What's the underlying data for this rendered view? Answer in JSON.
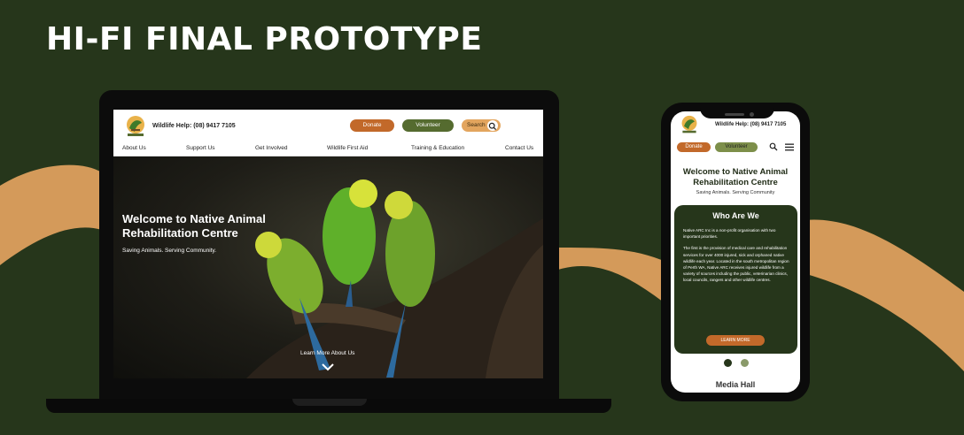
{
  "page_title": "HI-FI FINAL PROTOTYPE",
  "colors": {
    "background": "#26361b",
    "accent_orange": "#c2692a",
    "accent_green": "#556b2f",
    "swoosh": "#d49a5a"
  },
  "desktop": {
    "wildlife_help": "Wildlife Help: (08) 9417 7105",
    "donate_label": "Donate",
    "volunteer_label": "Volunteer",
    "search_label": "Search",
    "nav": [
      "About Us",
      "Support Us",
      "Get Involved",
      "Wildlife First Aid",
      "Training & Education",
      "Contact Us"
    ],
    "hero_title": "Welcome to Native Animal Rehabilitation Centre",
    "hero_subtitle": "Saving Animals. Serving Community.",
    "learn_more_label": "Learn More About Us"
  },
  "mobile": {
    "wildlife_help": "Wildlife Help: (08) 9417 7105",
    "donate_label": "Donate",
    "volunteer_label": "Volunteer",
    "hero_title": "Welcome to Native Animal Rehabilitation Centre",
    "hero_subtitle": "Saving Animals. Serving Community",
    "card_title": "Who Are We",
    "card_para1": "Native ARC Inc is a non-profit organisation with two important priorities.",
    "card_para2": "The first is the provision of medical care and rehabilitation services for over 4000 injured, sick and orphaned native wildlife each year. Located in the south metropolitan region of Perth WA, Native ARC receives injured wildlife from a variety of sources including the public, veterinarian clinics, local councils, rangers and other wildlife centres.",
    "learn_more_label": "LEARN MORE",
    "media_hall_title": "Media Hall"
  }
}
